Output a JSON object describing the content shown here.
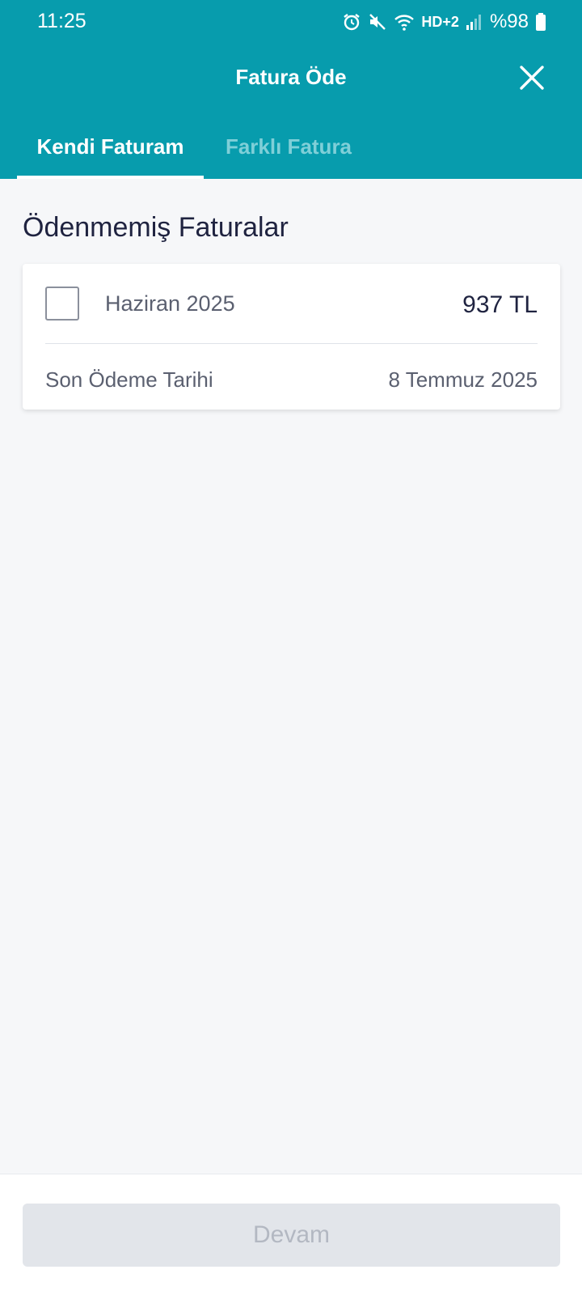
{
  "status_bar": {
    "time": "11:25",
    "network": "HD+2",
    "battery": "%98",
    "icons": [
      "alarm-icon",
      "mute-icon",
      "wifi-icon",
      "signal-icon",
      "battery-icon"
    ]
  },
  "header": {
    "title": "Fatura Öde",
    "close_icon": "close-icon"
  },
  "tabs": [
    {
      "label": "Kendi Faturam",
      "active": true
    },
    {
      "label": "Farklı Fatura",
      "active": false
    }
  ],
  "section": {
    "title": "Ödenmemiş Faturalar"
  },
  "invoice": {
    "period": "Haziran 2025",
    "amount": "937 TL",
    "due_label": "Son Ödeme Tarihi",
    "due_date": "8 Temmuz 2025",
    "checked": false
  },
  "footer": {
    "continue_label": "Devam"
  },
  "colors": {
    "brand": "#079cad",
    "background": "#f6f7f9",
    "disabled_button": "#e2e5ea",
    "disabled_text": "#b3b8c2"
  }
}
